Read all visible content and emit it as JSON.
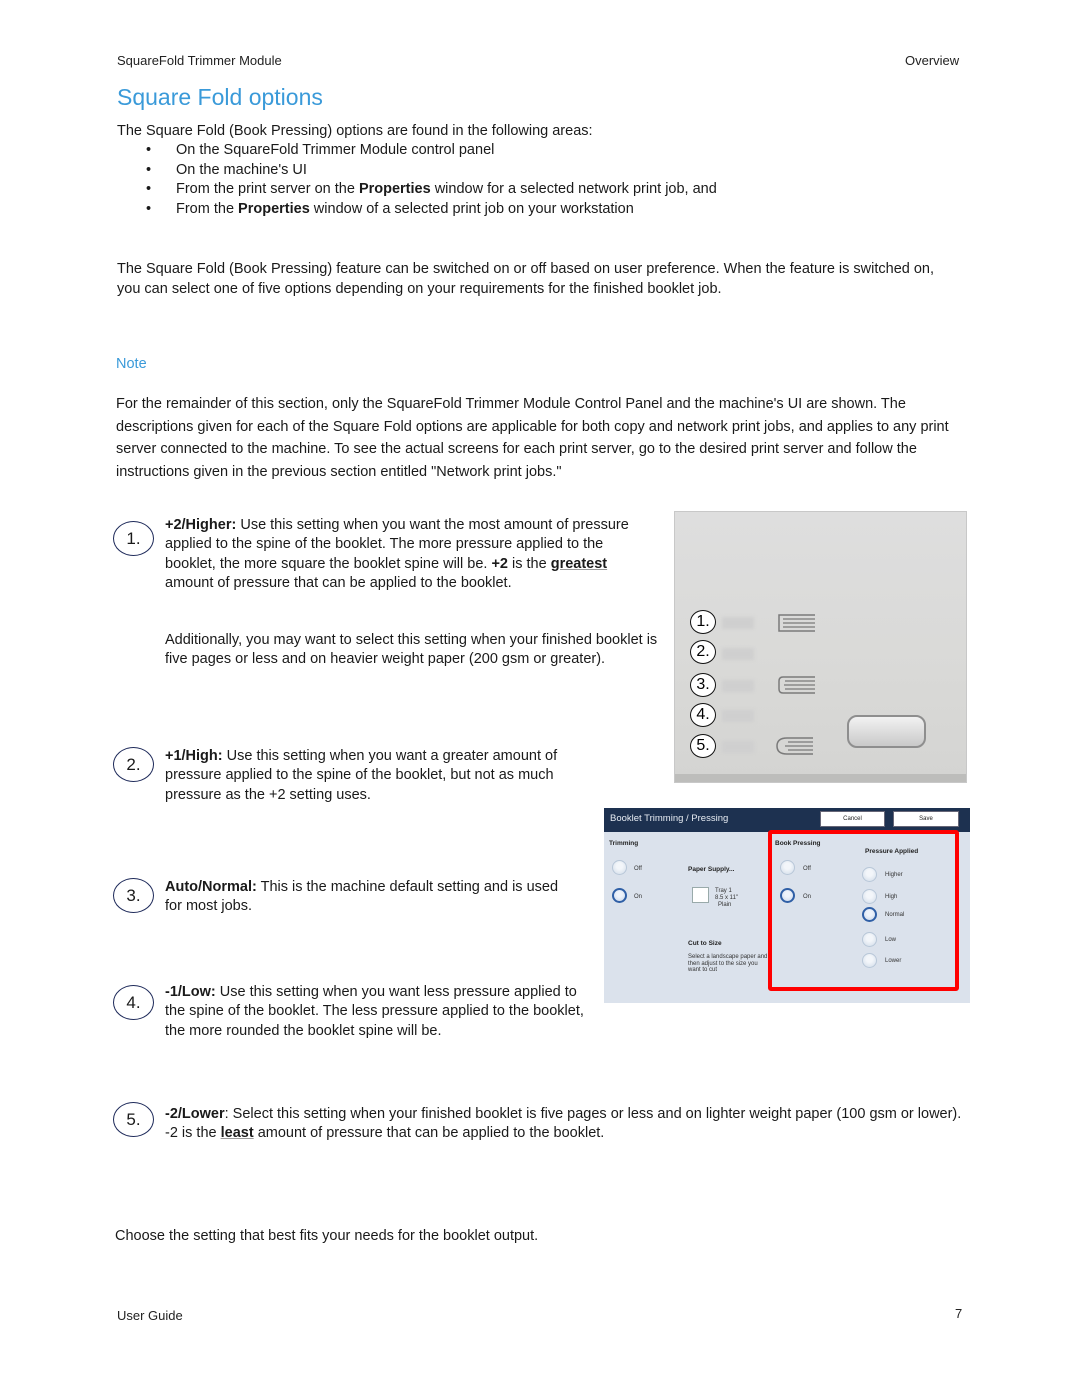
{
  "header": {
    "left": "SquareFold Trimmer Module",
    "right": "Overview"
  },
  "title": "Square Fold options",
  "intro": "The Square Fold (Book Pressing) options are found in the following areas:",
  "bullets": [
    {
      "pre": "On the SquareFold Trimmer Module control panel",
      "bold": "",
      "post": ""
    },
    {
      "pre": "On the machine's UI",
      "bold": "",
      "post": ""
    },
    {
      "pre": "From the print server on the ",
      "bold": "Properties",
      "post": " window for a selected network print job, and"
    },
    {
      "pre": "From the ",
      "bold": "Properties",
      "post": " window of a selected print job on your workstation"
    }
  ],
  "paragraph2": "The Square Fold (Book Pressing) feature can be switched on or off based on user preference. When the feature is switched on, you can select one of five options depending on your requirements for the finished booklet job.",
  "note_label": "Note",
  "note_text": "For the remainder of this section, only the SquareFold Trimmer Module Control Panel and the machine's UI are shown. The descriptions given for each of the Square Fold options are applicable for both copy and network print jobs, and applies to any print server connected to the machine.  To see the actual screens for each print server, go to the desired print server and follow the instructions given in the previous section entitled \"Network print jobs.\"",
  "options": [
    {
      "number": "1.",
      "label": "+2/Higher:",
      "text_a": " Use this setting when you want the most amount of pressure applied to the spine of the booklet. The more pressure applied to the booklet, the more square the booklet spine will be. ",
      "bold_b": "+2",
      "text_c": " is the ",
      "underline": "greatest",
      "text_d": " amount of pressure that can be applied to the booklet.",
      "extra": "Additionally, you may want to select this setting when your finished booklet is five pages or less and on heavier weight paper (200 gsm or greater)."
    },
    {
      "number": "2.",
      "label": "+1/High:",
      "text": " Use this setting when you want a greater amount of pressure applied to the spine of the booklet, but not as much pressure as the +2 setting uses."
    },
    {
      "number": "3.",
      "label": "Auto/Normal:",
      "text": " This is the machine default setting and is used for most jobs."
    },
    {
      "number": "4.",
      "label": "-1/Low:",
      "text": " Use this setting when you want less pressure applied to the spine of the booklet. The less pressure applied to the booklet, the more rounded the booklet spine will be."
    },
    {
      "number": "5.",
      "label": "-2/Lower",
      "text_a": ": Select this setting when your finished booklet is five pages or less and on lighter weight paper (100 gsm or lower). -2 is the ",
      "underline": "least",
      "text_b": " amount of pressure that can be applied to the booklet."
    }
  ],
  "control_panel": {
    "numbers": [
      "1.",
      "2.",
      "3.",
      "4.",
      "5."
    ],
    "icons": [
      "square-spine-icon",
      "",
      "semi-square-spine-icon",
      "",
      "rounded-spine-icon"
    ]
  },
  "machine_ui": {
    "title": "Booklet Trimming / Pressing",
    "cancel": "Cancel",
    "save": "Save",
    "trimming": {
      "label": "Trimming",
      "options": [
        {
          "label": "Off",
          "selected": false
        },
        {
          "label": "On",
          "selected": true
        }
      ]
    },
    "paper_supply": {
      "label": "Paper Supply...",
      "tray": "Tray 1",
      "size": "8.5 x 11\"",
      "type": "Plain"
    },
    "cut_to_size": {
      "label": "Cut to Size",
      "text": "Select a landscape paper and then adjust to the size you want to cut"
    },
    "book_pressing": {
      "label": "Book Pressing",
      "options": [
        {
          "label": "Off",
          "selected": false
        },
        {
          "label": "On",
          "selected": true
        }
      ]
    },
    "pressure_applied": {
      "label": "Pressure Applied",
      "options": [
        {
          "label": "Higher",
          "selected": false
        },
        {
          "label": "High",
          "selected": false
        },
        {
          "label": "Normal",
          "selected": true
        },
        {
          "label": "Low",
          "selected": false
        },
        {
          "label": "Lower",
          "selected": false
        }
      ]
    },
    "highlight_color": "#ff0000",
    "titlebar_color": "#1d3150"
  },
  "closing": "Choose the setting that best fits your needs for the booklet output.",
  "footer": {
    "left": "User Guide",
    "page": "7"
  }
}
